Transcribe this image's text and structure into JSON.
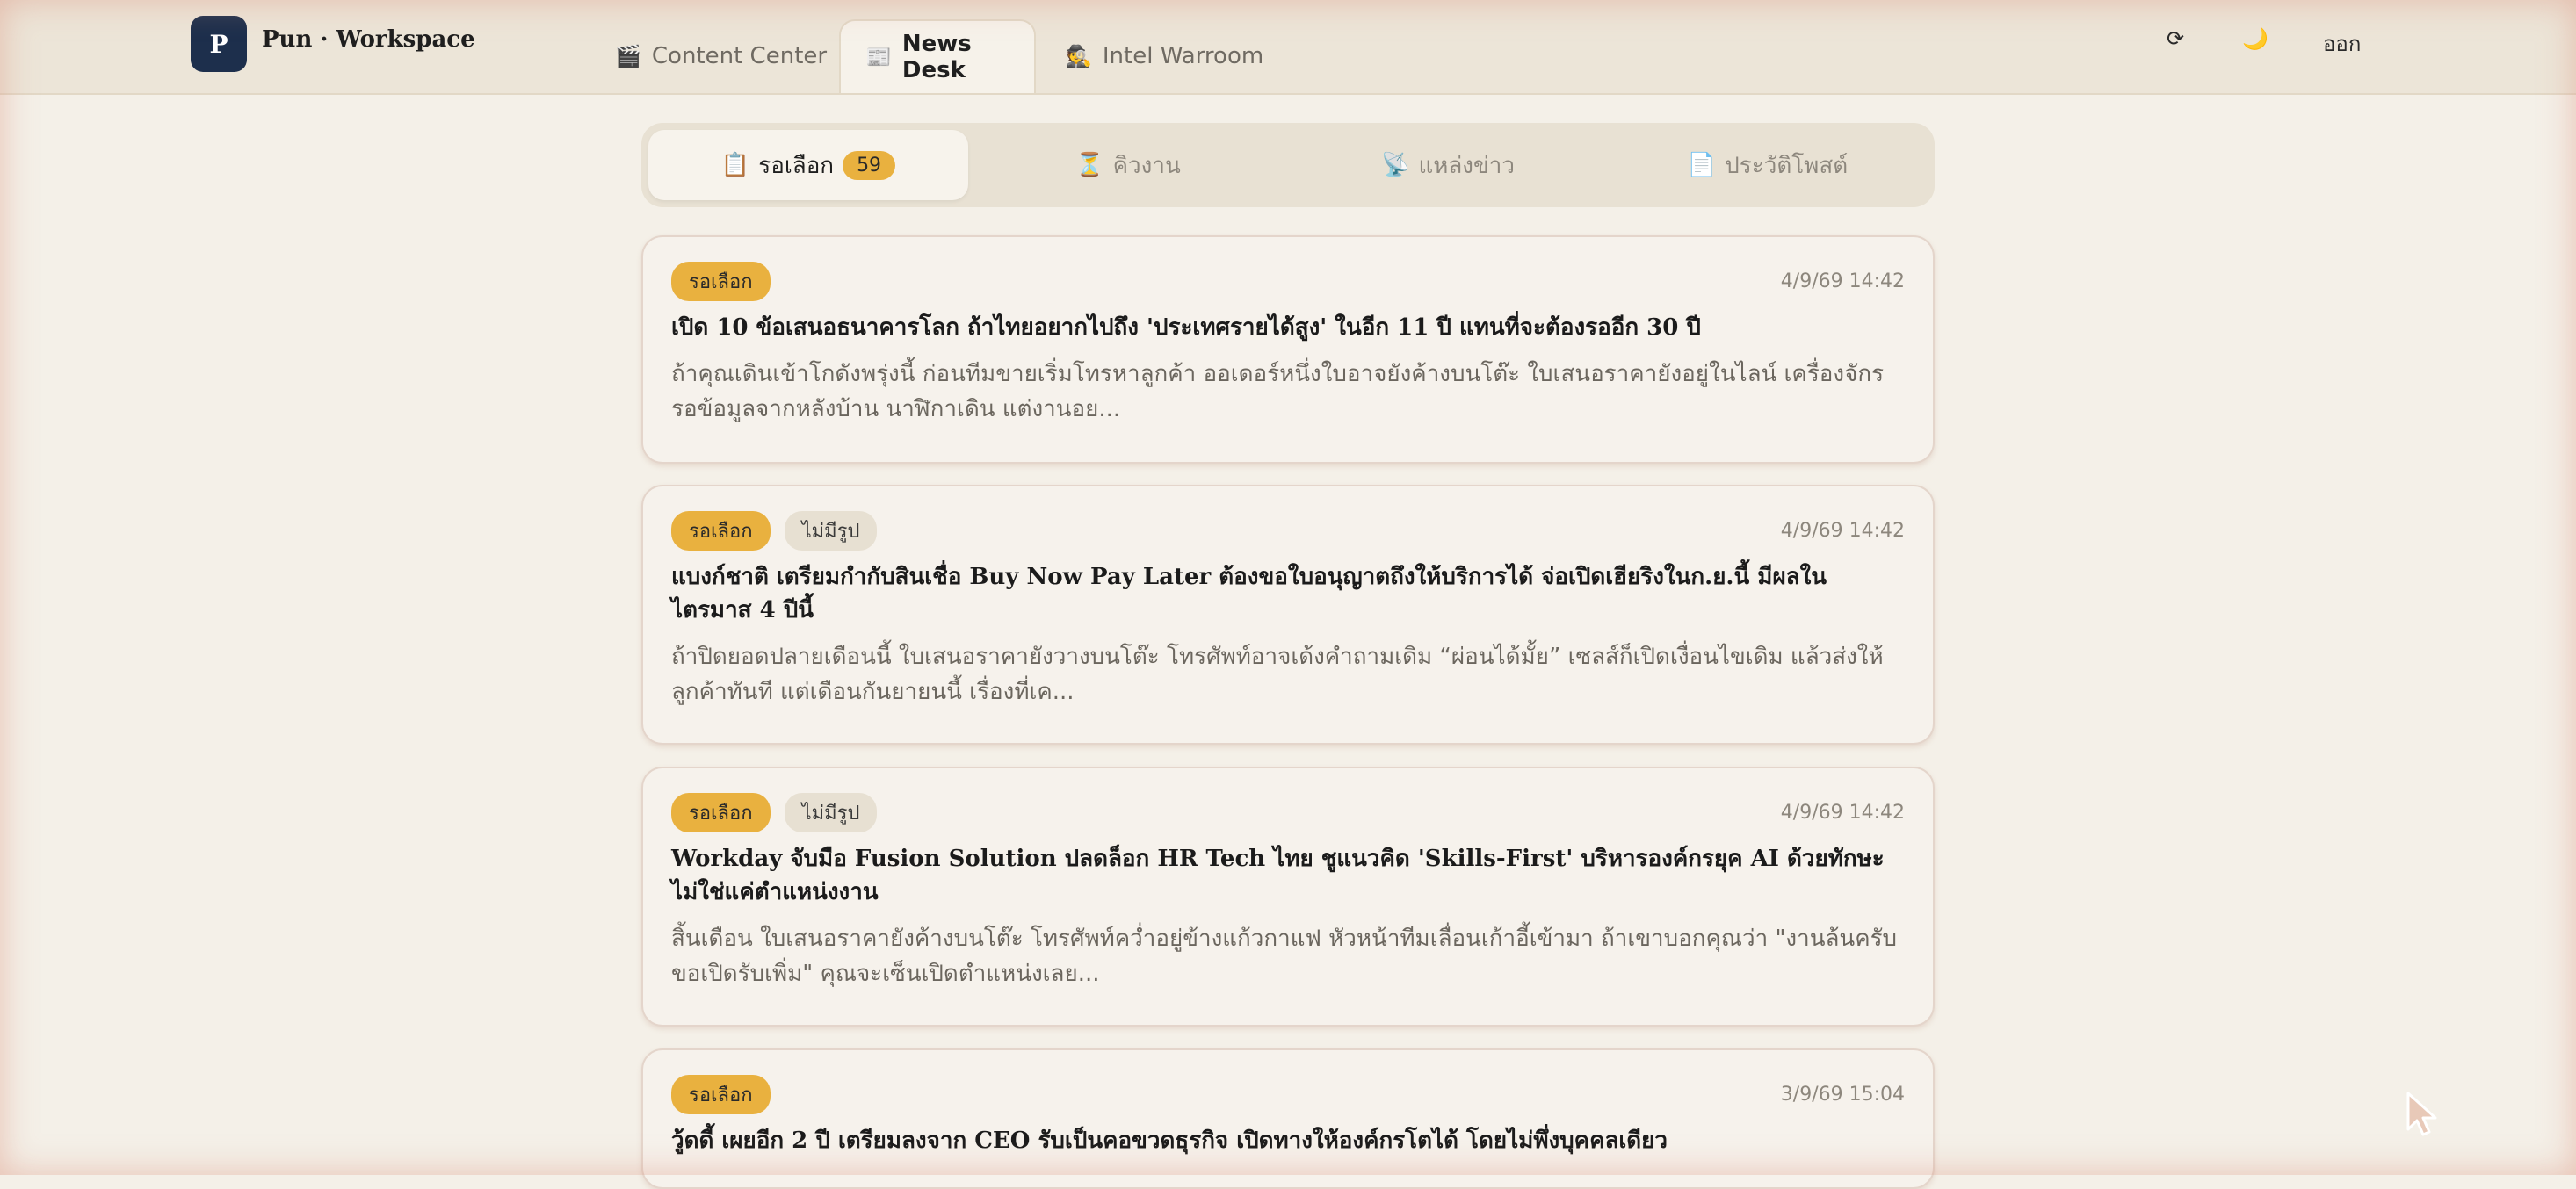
{
  "header": {
    "logo_letter": "P",
    "brand": "Pun · Workspace",
    "tabs": [
      {
        "icon": "🎬",
        "label": "Content Center"
      },
      {
        "icon": "📰",
        "label": "News Desk"
      },
      {
        "icon": "🕵",
        "label": "Intel Warroom"
      }
    ],
    "refresh_icon": "⟳",
    "theme_icon": "🌙",
    "logout_label": "ออก"
  },
  "subtabs": [
    {
      "icon": "📋",
      "label": "รอเลือก",
      "count": "59"
    },
    {
      "icon": "⏳",
      "label": "คิวงาน"
    },
    {
      "icon": "📡",
      "label": "แหล่งข่าว"
    },
    {
      "icon": "📄",
      "label": "ประวัติโพสต์"
    }
  ],
  "cards": [
    {
      "status": "รอเลือก",
      "date": "4/9/69 14:42",
      "title": "เปิด 10 ข้อเสนอธนาคารโลก ถ้าไทยอยากไปถึง 'ประเทศรายได้สูง' ในอีก 11 ปี แทนที่จะต้องรออีก 30 ปี",
      "excerpt": "ถ้าคุณเดินเข้าโกดังพรุ่งนี้ ก่อนทีมขายเริ่มโทรหาลูกค้า ออเดอร์หนึ่งใบอาจยังค้างบนโต๊ะ ใบเสนอราคายังอยู่ในไลน์ เครื่องจักรรอข้อมูลจากหลังบ้าน นาฬิกาเดิน แต่งานอย..."
    },
    {
      "status": "รอเลือก",
      "tag": "ไม่มีรูป",
      "date": "4/9/69 14:42",
      "title": "แบงก์ชาติ เตรียมกำกับสินเชื่อ Buy Now Pay Later ต้องขอใบอนุญาตถึงให้บริการได้ จ่อเปิดเฮียริงในก.ย.นี้ มีผลในไตรมาส 4 ปีนี้",
      "excerpt": "ถ้าปิดยอดปลายเดือนนี้ ใบเสนอราคายังวางบนโต๊ะ โทรศัพท์อาจเด้งคำถามเดิม “ผ่อนได้มั้ย” เซลส์ก็เปิดเงื่อนไขเดิม แล้วส่งให้ลูกค้าทันที แต่เดือนกันยายนนี้ เรื่องที่เค..."
    },
    {
      "status": "รอเลือก",
      "tag": "ไม่มีรูป",
      "date": "4/9/69 14:42",
      "title": "Workday จับมือ Fusion Solution ปลดล็อก HR Tech ไทย ชูแนวคิด 'Skills-First' บริหารองค์กรยุค AI ด้วยทักษะ ไม่ใช่แค่ตำแหน่งงาน",
      "excerpt": "สิ้นเดือน ใบเสนอราคายังค้างบนโต๊ะ โทรศัพท์คว่ำอยู่ข้างแก้วกาแฟ หัวหน้าทีมเลื่อนเก้าอี้เข้ามา ถ้าเขาบอกคุณว่า \"งานล้นครับ ขอเปิดรับเพิ่ม\" คุณจะเซ็นเปิดตำแหน่งเลย..."
    },
    {
      "status": "รอเลือก",
      "date": "3/9/69 15:04",
      "title": "วู้ดดี้ เผยอีก 2 ปี เตรียมลงจาก CEO รับเป็นคอขวดธุรกิจ เปิดทางให้องค์กรโตได้ โดยไม่พึ่งบุคคลเดียว",
      "excerpt": ""
    }
  ]
}
